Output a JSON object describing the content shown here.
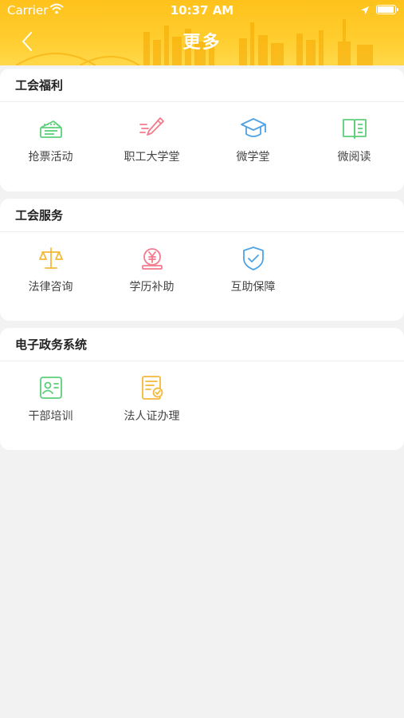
{
  "status": {
    "carrier": "Carrier",
    "time": "10:37 AM"
  },
  "nav": {
    "title": "更多"
  },
  "sections": [
    {
      "title": "工会福利",
      "items": [
        {
          "label": "抢票活动",
          "icon": "ticket-icon",
          "color": "#5dcf7a"
        },
        {
          "label": "职工大学堂",
          "icon": "pen-icon",
          "color": "#f47a8c"
        },
        {
          "label": "微学堂",
          "icon": "graduation-cap-icon",
          "color": "#4ea3e6"
        },
        {
          "label": "微阅读",
          "icon": "book-icon",
          "color": "#5dcf7a"
        }
      ]
    },
    {
      "title": "工会服务",
      "items": [
        {
          "label": "法律咨询",
          "icon": "scales-icon",
          "color": "#f5b83a"
        },
        {
          "label": "学历补助",
          "icon": "yuan-coin-icon",
          "color": "#f47a8c"
        },
        {
          "label": "互助保障",
          "icon": "shield-check-icon",
          "color": "#4ea3e6"
        }
      ]
    },
    {
      "title": "电子政务系统",
      "items": [
        {
          "label": "干部培训",
          "icon": "id-card-icon",
          "color": "#5dcf7a"
        },
        {
          "label": "法人证办理",
          "icon": "certificate-icon",
          "color": "#f5b83a"
        }
      ]
    }
  ]
}
